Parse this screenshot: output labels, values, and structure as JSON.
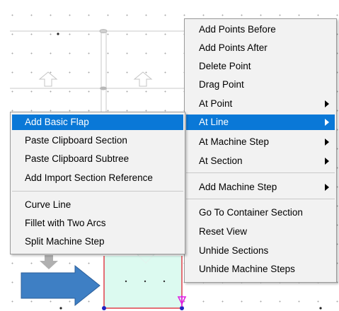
{
  "left_menu": {
    "items": [
      {
        "label": "Add Basic Flap"
      },
      {
        "label": "Paste Clipboard Section"
      },
      {
        "label": "Paste Clipboard Subtree"
      },
      {
        "label": "Add Import Section Reference"
      },
      {
        "label": "Curve Line"
      },
      {
        "label": "Fillet with Two Arcs"
      },
      {
        "label": "Split Machine Step"
      }
    ],
    "highlighted": "Add Basic Flap"
  },
  "right_menu": {
    "items": [
      {
        "label": "Add Points Before"
      },
      {
        "label": "Add Points After"
      },
      {
        "label": "Delete Point"
      },
      {
        "label": "Drag Point"
      },
      {
        "label": "At Point",
        "submenu": true
      },
      {
        "label": "At Line",
        "submenu": true
      },
      {
        "label": "At Machine Step",
        "submenu": true
      },
      {
        "label": "At Section",
        "submenu": true
      },
      {
        "label": "Add Machine Step",
        "submenu": true
      },
      {
        "label": "Go To Container Section"
      },
      {
        "label": "Reset View"
      },
      {
        "label": "Unhide Sections"
      },
      {
        "label": "Unhide Machine Steps"
      }
    ],
    "highlighted": "At Line"
  },
  "colors": {
    "highlight": "#0a78d7",
    "menu_bg": "#f2f2f2",
    "section_fill": "#dcfaf0",
    "section_border": "#e0404a",
    "arrow_fill": "#3e7fc4",
    "marker_magenta": "#e020e0",
    "point_blue": "#2020c0"
  },
  "icons": [
    "up-arrow-icon",
    "down-arrow-icon",
    "right-arrow-icon",
    "point-marker-icon"
  ]
}
